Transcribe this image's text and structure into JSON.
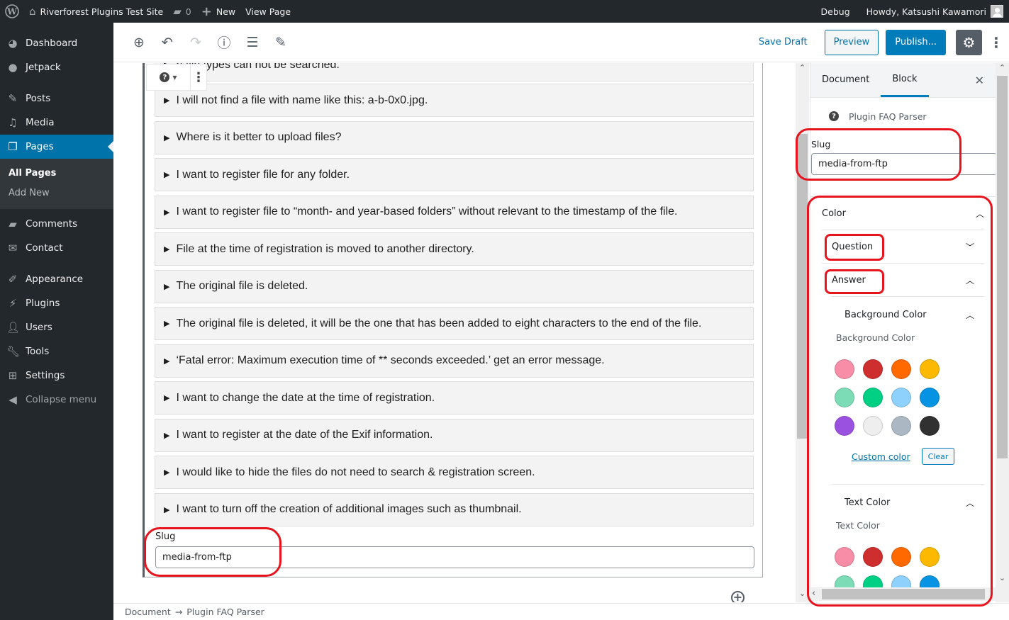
{
  "admin_bar": {
    "site_name": "Riverforest Plugins Test Site",
    "comments_count": "0",
    "new_label": "New",
    "view_page_label": "View Page",
    "debug_label": "Debug",
    "greeting": "Howdy, Katsushi Kawamori"
  },
  "sidebar": {
    "items": [
      {
        "label": "Dashboard",
        "icon": "dashboard-icon"
      },
      {
        "label": "Jetpack",
        "icon": "jetpack-icon"
      },
      {
        "label": "Posts",
        "icon": "pin-icon"
      },
      {
        "label": "Media",
        "icon": "media-icon"
      },
      {
        "label": "Pages",
        "icon": "pages-icon",
        "active": true
      },
      {
        "label": "Comments",
        "icon": "comment-icon"
      },
      {
        "label": "Contact",
        "icon": "envelope-icon"
      },
      {
        "label": "Appearance",
        "icon": "brush-icon"
      },
      {
        "label": "Plugins",
        "icon": "plug-icon"
      },
      {
        "label": "Users",
        "icon": "user-icon"
      },
      {
        "label": "Tools",
        "icon": "wrench-icon"
      },
      {
        "label": "Settings",
        "icon": "sliders-icon"
      }
    ],
    "submenu": [
      "All Pages",
      "Add New"
    ],
    "collapse_label": "Collapse menu"
  },
  "toolbar": {
    "save_draft": "Save Draft",
    "preview": "Preview",
    "publish": "Publish..."
  },
  "block": {
    "partial_first_item": "n file types can not be searched.",
    "faq_items": [
      "I will not find a file with name like this: a-b-0x0.jpg.",
      "Where is it better to upload files?",
      "I want to register file for any folder.",
      "I want to register file to “month- and year-based folders” without relevant to the timestamp of the file.",
      "File at the time of registration is moved to another directory.",
      "The original file is deleted.",
      "The original file is deleted, it will be the one that has been added to eight characters to the end of the file.",
      "‘Fatal error: Maximum execution time of ** seconds exceeded.’ get an error message.",
      "I want to change the date at the time of registration.",
      "I want to register at the date of the Exif information.",
      "I would like to hide the files do not need to search & registration screen.",
      "I want to turn off the creation of additional images such as thumbnail."
    ],
    "slug_label": "Slug",
    "slug_value": "media-from-ftp"
  },
  "breadcrumb": {
    "root": "Document",
    "arrow": "→",
    "current": "Plugin FAQ Parser"
  },
  "settings": {
    "tabs": [
      "Document",
      "Block"
    ],
    "active_tab": "Block",
    "block_name": "Plugin FAQ Parser",
    "slug_label": "Slug",
    "slug_value": "media-from-ftp",
    "color_panel": {
      "title": "Color",
      "question_label": "Question",
      "answer_label": "Answer",
      "background": {
        "title": "Background Color",
        "label": "Background Color"
      },
      "text": {
        "title": "Text Color",
        "label": "Text Color"
      },
      "custom_color": "Custom color",
      "clear": "Clear",
      "palette": [
        "#f78da7",
        "#cf2e2e",
        "#ff6900",
        "#fcb900",
        "#7bdcb5",
        "#00d084",
        "#8ed1fc",
        "#0693e3",
        "#9b51e0",
        "#eeeeee",
        "#abb8c3",
        "#313131"
      ]
    }
  },
  "colors": {
    "admin_bar": "#23282d",
    "accent": "#0073aa",
    "annotation": "#e8141d"
  }
}
